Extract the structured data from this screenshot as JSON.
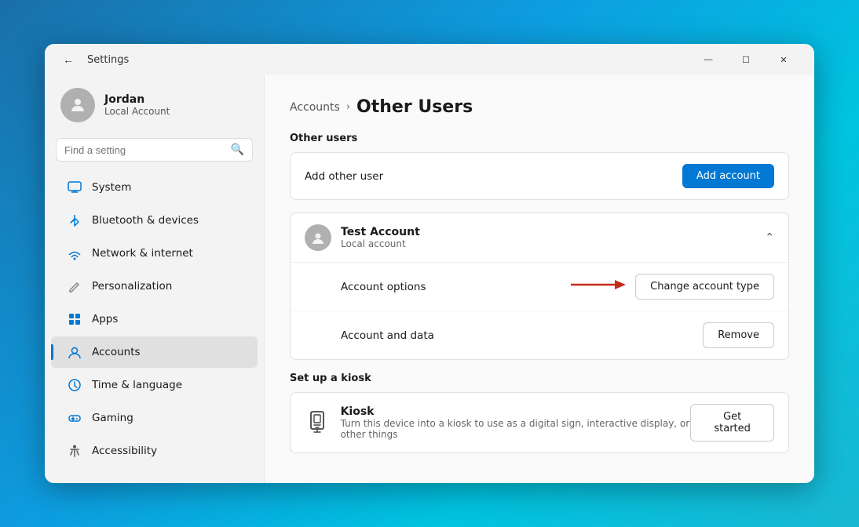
{
  "window": {
    "title": "Settings",
    "controls": {
      "minimize": "—",
      "maximize": "☐",
      "close": "✕"
    }
  },
  "sidebar": {
    "user": {
      "name": "Jordan",
      "type": "Local Account"
    },
    "search": {
      "placeholder": "Find a setting"
    },
    "nav": [
      {
        "id": "system",
        "label": "System",
        "icon": "💻",
        "iconClass": "icon-system"
      },
      {
        "id": "bluetooth",
        "label": "Bluetooth & devices",
        "icon": "⬤",
        "iconClass": "icon-bluetooth"
      },
      {
        "id": "network",
        "label": "Network & internet",
        "icon": "◈",
        "iconClass": "icon-network"
      },
      {
        "id": "personalization",
        "label": "Personalization",
        "icon": "✏",
        "iconClass": "icon-personalization"
      },
      {
        "id": "apps",
        "label": "Apps",
        "icon": "▦",
        "iconClass": "icon-apps"
      },
      {
        "id": "accounts",
        "label": "Accounts",
        "icon": "👤",
        "iconClass": "icon-accounts",
        "active": true
      },
      {
        "id": "time",
        "label": "Time & language",
        "icon": "🕐",
        "iconClass": "icon-time"
      },
      {
        "id": "gaming",
        "label": "Gaming",
        "icon": "🎮",
        "iconClass": "icon-gaming"
      },
      {
        "id": "accessibility",
        "label": "Accessibility",
        "icon": "♿",
        "iconClass": "icon-accessibility"
      }
    ]
  },
  "content": {
    "breadcrumb_parent": "Accounts",
    "breadcrumb_arrow": "›",
    "breadcrumb_current": "Other Users",
    "other_users_label": "Other users",
    "add_user_row": {
      "label": "Add other user",
      "button": "Add account"
    },
    "test_account": {
      "name": "Test Account",
      "type": "Local account",
      "options": [
        {
          "label": "Account options",
          "arrow": "→",
          "button": "Change account type"
        },
        {
          "label": "Account and data",
          "button": "Remove"
        }
      ]
    },
    "kiosk_section": {
      "label": "Set up a kiosk",
      "name": "Kiosk",
      "description": "Turn this device into a kiosk to use as a digital sign, interactive display, or other things",
      "button": "Get started"
    }
  }
}
